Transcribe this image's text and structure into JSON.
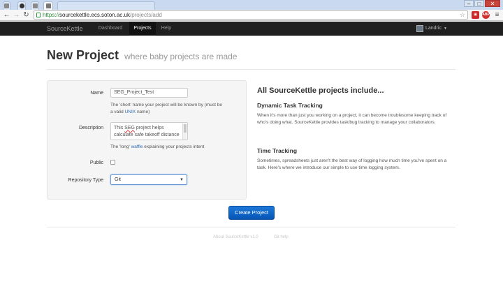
{
  "browser": {
    "tabs": [
      {
        "label": ""
      },
      {
        "label": ""
      },
      {
        "label": ""
      },
      {
        "label": ""
      }
    ],
    "url": {
      "scheme": "https://",
      "host": "sourcekettle.ecs.soton.ac.uk",
      "path": "/projects/add"
    },
    "window_controls": {
      "minimize": "–",
      "maximize": "□",
      "close": "✕"
    },
    "extensions": [
      {
        "icon": "red-extension-icon",
        "text": "",
        "color": "#cc2a2a"
      },
      {
        "icon": "adblock-icon",
        "text": "ABP",
        "color": "#d0312d"
      }
    ]
  },
  "navbar": {
    "brand": "SourceKettle",
    "links": [
      {
        "label": "Dashboard",
        "active": false
      },
      {
        "label": "Projects",
        "active": true
      },
      {
        "label": "Help",
        "active": false
      }
    ],
    "user": "Landric"
  },
  "header": {
    "title": "New Project",
    "subtitle": "where baby projects are made"
  },
  "form": {
    "name": {
      "label": "Name",
      "value": "SEG_Project_Test",
      "help_before": "The 'short' name your project will be known by (must be a valid ",
      "help_link": "UNIX",
      "help_after": " name)"
    },
    "description": {
      "label": "Description",
      "line1_prefix": "This ",
      "line1_misspelled": "SEG",
      "line1_suffix": " project helps",
      "line2": "calculate safe takeoff distance",
      "help_before": "The 'long' ",
      "help_link": "waffle",
      "help_after": " explaining your projects intent"
    },
    "public": {
      "label": "Public",
      "checked": false
    },
    "repository_type": {
      "label": "Repository Type",
      "value": "Git"
    },
    "submit": "Create Project"
  },
  "info": {
    "title": "All SourceKettle projects include...",
    "sections": [
      {
        "heading": "Dynamic Task Tracking",
        "text": "When it's more than just you working on a project, it can become troublesome keeping track of who's doing what. SourceKettle provides task/bug tracking to manage your collaborators."
      },
      {
        "heading": "Time Tracking",
        "text": "Sometimes, spreadsheets just aren't the best way of logging how much time you've spent on a task. Here's where we introduce our simple to use time logging system."
      }
    ]
  },
  "footer": {
    "about": "About SourceKettle v1.0",
    "git_help": "Git help"
  },
  "colors": {
    "navbar_bg": "#1f1f1f",
    "primary_button": "#0a5fc4",
    "link": "#2a6bb0"
  }
}
